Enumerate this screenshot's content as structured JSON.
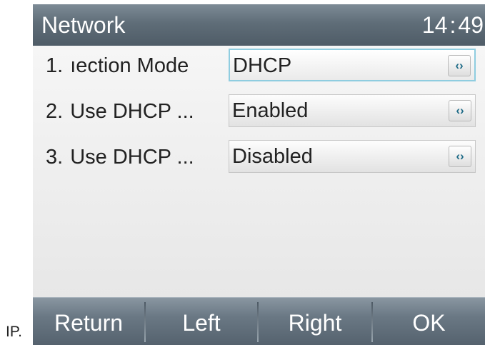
{
  "outer_label": "IP.",
  "header": {
    "title": "Network",
    "time_hours": "14",
    "time_sep": ":",
    "time_minutes": "49"
  },
  "rows": [
    {
      "index": "1.",
      "label": "ıection Mode",
      "value": "DHCP",
      "selector_icon": "left-right-arrows-icon"
    },
    {
      "index": "2.",
      "label": "Use DHCP ...",
      "value": "Enabled",
      "selector_icon": "left-right-arrows-icon"
    },
    {
      "index": "3.",
      "label": "Use DHCP ...",
      "value": "Disabled",
      "selector_icon": "left-right-arrows-icon"
    }
  ],
  "arrow_glyph": "‹›",
  "softkeys": [
    "Return",
    "Left",
    "Right",
    "OK"
  ],
  "colors": {
    "title_bar": "#5f6d78",
    "focus_border": "#8fcde0",
    "arrow_icon": "#1e6b87"
  }
}
